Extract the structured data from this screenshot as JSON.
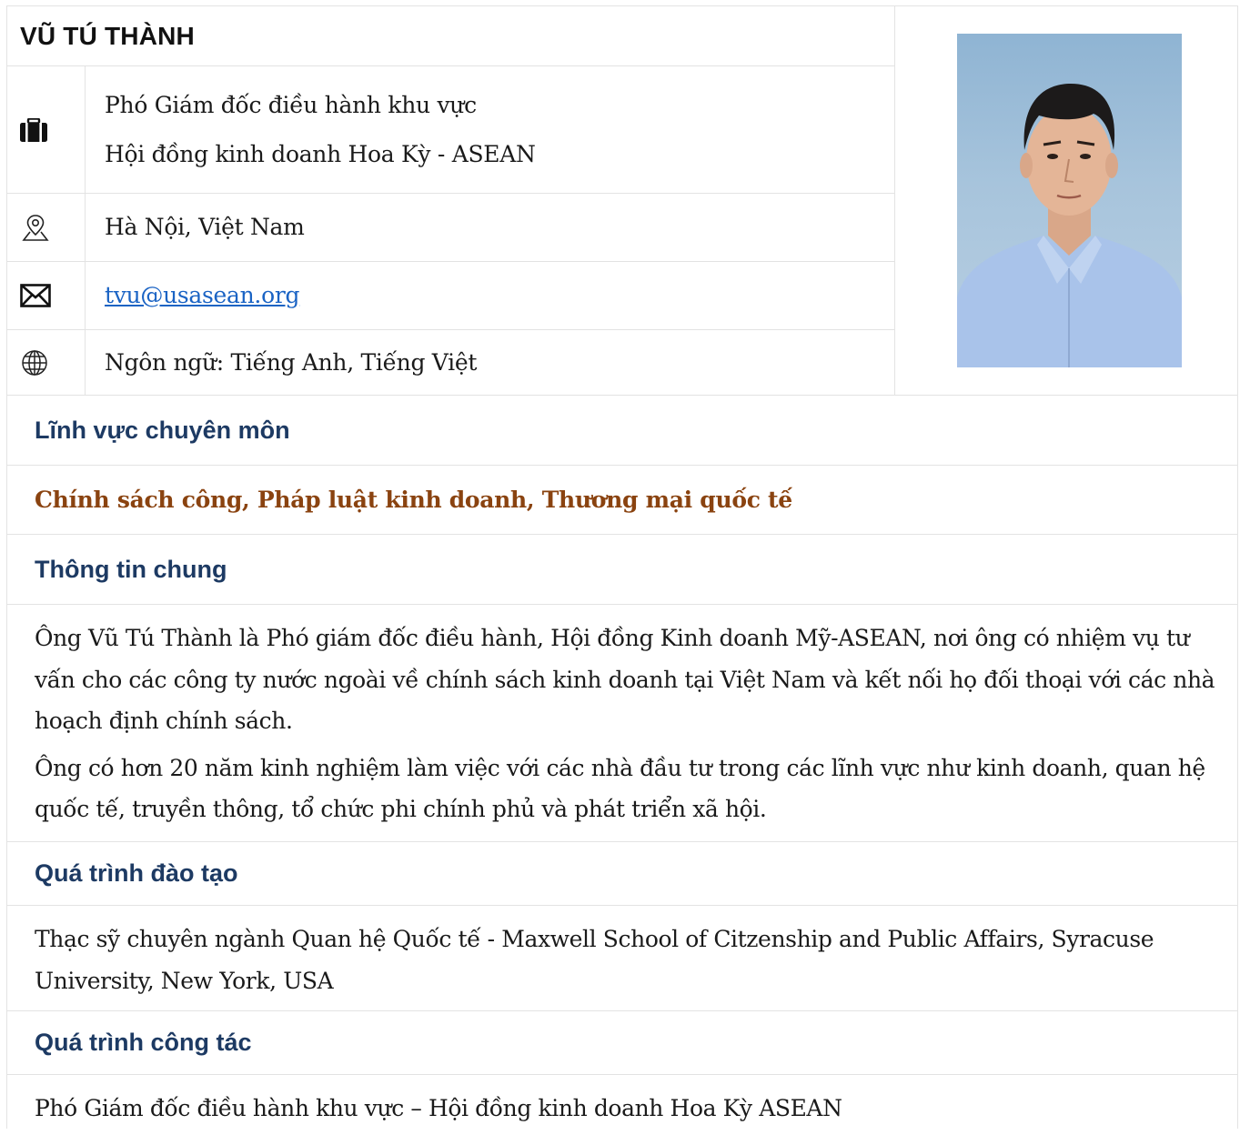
{
  "profile": {
    "name": "VŨ TÚ THÀNH",
    "job_line1": "Phó Giám đốc điều hành khu vực",
    "job_line2": "Hội đồng kinh doanh Hoa Kỳ - ASEAN",
    "location": "Hà Nội, Việt Nam",
    "email": "tvu@usasean.org",
    "languages": "Ngôn ngữ: Tiếng Anh, Tiếng Việt",
    "icons": [
      "briefcase-icon",
      "location-pin-icon",
      "envelope-icon",
      "globe-icon"
    ]
  },
  "sections": {
    "expertise_title": "Lĩnh vực chuyên môn",
    "expertise_value": "Chính sách công, Pháp luật kinh doanh, Thương mại quốc tế",
    "general_title": "Thông tin chung",
    "general_p1": "Ông Vũ Tú Thành là Phó giám đốc điều hành, Hội đồng Kinh doanh Mỹ-ASEAN, nơi ông có nhiệm vụ tư vấn cho các công ty nước ngoài về chính sách kinh doanh tại Việt Nam và kết nối họ đối thoại với các nhà hoạch định chính sách.",
    "general_p2": "Ông có hơn 20 năm kinh nghiệm làm việc với các nhà đầu tư trong các lĩnh vực như kinh doanh, quan hệ quốc tế, truyền thông, tổ chức phi chính phủ và phát triển xã hội.",
    "education_title": "Quá trình đào tạo",
    "education_value": "Thạc sỹ chuyên ngành Quan hệ Quốc tế - Maxwell School of Citzenship and Public Affairs, Syracuse University, New York, USA",
    "work_title": "Quá trình công tác",
    "work_value": "Phó Giám đốc điều hành khu vực – Hội đồng kinh doanh Hoa Kỳ ASEAN"
  },
  "colors": {
    "heading": "#1d3a63",
    "expertise": "#8a4310",
    "link": "#1a63c4",
    "border": "#e3e3e3"
  }
}
